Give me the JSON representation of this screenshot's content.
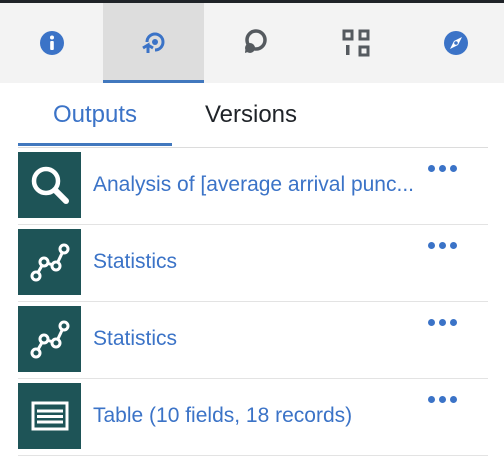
{
  "toolbar": {
    "icons": [
      {
        "name": "info-icon"
      },
      {
        "name": "history-icon"
      },
      {
        "name": "comments-icon"
      },
      {
        "name": "outline-icon"
      },
      {
        "name": "explore-icon"
      }
    ],
    "active_index": 1
  },
  "tabs": [
    {
      "label": "Outputs",
      "active": true
    },
    {
      "label": "Versions",
      "active": false
    }
  ],
  "outputs": [
    {
      "icon": "search-icon",
      "label": "Analysis of [average arrival punc..."
    },
    {
      "icon": "statistics-icon",
      "label": "Statistics"
    },
    {
      "icon": "statistics-icon",
      "label": "Statistics"
    },
    {
      "icon": "table-icon",
      "label": "Table (10 fields, 18 records)"
    }
  ],
  "colors": {
    "accent": "#4178be",
    "link": "#3b73c7",
    "thumb_bg": "#1e5457"
  }
}
